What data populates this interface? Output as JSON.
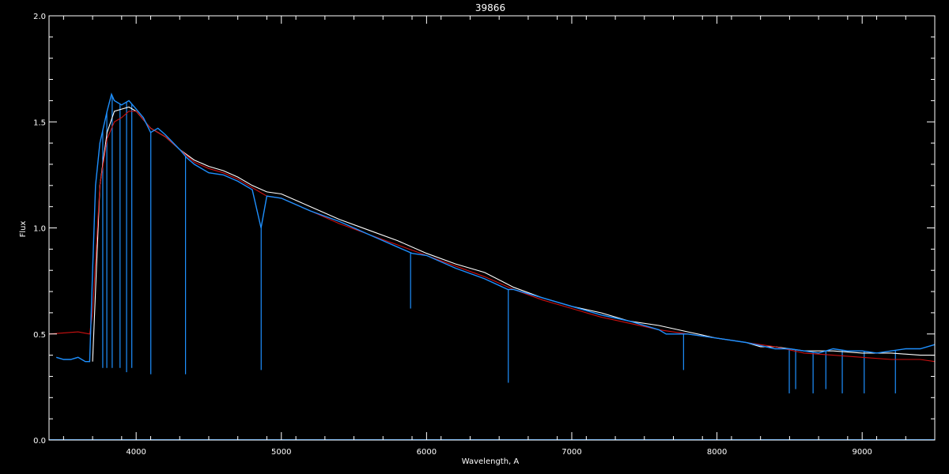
{
  "chart_data": {
    "type": "line",
    "title": "39866",
    "xlabel": "Wavelength, A",
    "ylabel": "Flux",
    "xlim": [
      3400,
      9500
    ],
    "ylim": [
      0.0,
      2.0
    ],
    "x_ticks": [
      4000,
      5000,
      6000,
      7000,
      8000,
      9000
    ],
    "y_ticks": [
      0.0,
      0.5,
      1.0,
      1.5,
      2.0
    ],
    "x_tick_labels": [
      "4000",
      "5000",
      "6000",
      "7000",
      "8000",
      "9000"
    ],
    "y_tick_labels": [
      "0.0",
      "0.5",
      "1.0",
      "1.5",
      "2.0"
    ],
    "grid": false,
    "background_color": "#000000",
    "axis_color": "#ffffff",
    "series": [
      {
        "color": "#ffffff",
        "x": [
          3700,
          3750,
          3800,
          3850,
          3900,
          3950,
          4000,
          4100,
          4200,
          4300,
          4400,
          4500,
          4600,
          4700,
          4800,
          4900,
          5000,
          5200,
          5400,
          5600,
          5800,
          6000,
          6200,
          6400,
          6600,
          6800,
          7000,
          7200,
          7400,
          7600,
          7800,
          8000,
          8200,
          8300,
          8400,
          8600,
          8800,
          9000,
          9200,
          9400,
          9500
        ],
        "y": [
          0.37,
          1.2,
          1.45,
          1.55,
          1.56,
          1.57,
          1.55,
          1.47,
          1.43,
          1.37,
          1.32,
          1.29,
          1.27,
          1.24,
          1.2,
          1.17,
          1.16,
          1.1,
          1.04,
          0.99,
          0.94,
          0.88,
          0.83,
          0.79,
          0.72,
          0.67,
          0.63,
          0.6,
          0.56,
          0.54,
          0.51,
          0.48,
          0.46,
          0.44,
          0.44,
          0.42,
          0.42,
          0.41,
          0.41,
          0.4,
          0.4
        ]
      },
      {
        "color": "#cc1111",
        "x": [
          3400,
          3600,
          3680,
          3700,
          3750,
          3800,
          3850,
          3900,
          3950,
          4000,
          4100,
          4200,
          4300,
          4400,
          4500,
          4600,
          4700,
          4800,
          4900,
          5000,
          5200,
          5400,
          5600,
          5800,
          6000,
          6200,
          6400,
          6600,
          6800,
          7000,
          7200,
          7400,
          7600,
          7800,
          8000,
          8200,
          8400,
          8600,
          8800,
          9000,
          9200,
          9400,
          9500
        ],
        "y": [
          0.5,
          0.51,
          0.5,
          0.6,
          1.2,
          1.42,
          1.5,
          1.52,
          1.55,
          1.55,
          1.47,
          1.43,
          1.37,
          1.31,
          1.28,
          1.26,
          1.23,
          1.19,
          1.15,
          1.14,
          1.08,
          1.02,
          0.97,
          0.92,
          0.87,
          0.82,
          0.77,
          0.71,
          0.66,
          0.62,
          0.58,
          0.55,
          0.52,
          0.5,
          0.48,
          0.46,
          0.44,
          0.41,
          0.4,
          0.39,
          0.38,
          0.38,
          0.37
        ]
      },
      {
        "color": "#1e90ff",
        "x": [
          3450,
          3500,
          3550,
          3600,
          3650,
          3680,
          3700,
          3720,
          3750,
          3800,
          3830,
          3850,
          3900,
          3950,
          4000,
          4050,
          4100,
          4150,
          4200,
          4300,
          4350,
          4400,
          4500,
          4600,
          4700,
          4800,
          4860,
          4900,
          5000,
          5200,
          5400,
          5600,
          5800,
          5900,
          6000,
          6200,
          6400,
          6560,
          6600,
          6800,
          7000,
          7200,
          7400,
          7600,
          7650,
          7800,
          8000,
          8200,
          8400,
          8500,
          8600,
          8700,
          8800,
          8900,
          9000,
          9100,
          9200,
          9300,
          9400,
          9500
        ],
        "y": [
          0.39,
          0.38,
          0.38,
          0.39,
          0.37,
          0.37,
          0.8,
          1.2,
          1.4,
          1.55,
          1.63,
          1.6,
          1.58,
          1.6,
          1.56,
          1.52,
          1.45,
          1.47,
          1.44,
          1.37,
          1.33,
          1.3,
          1.26,
          1.25,
          1.22,
          1.18,
          1.0,
          1.15,
          1.14,
          1.08,
          1.03,
          0.97,
          0.91,
          0.88,
          0.87,
          0.81,
          0.76,
          0.71,
          0.71,
          0.67,
          0.63,
          0.59,
          0.56,
          0.52,
          0.5,
          0.5,
          0.48,
          0.46,
          0.43,
          0.43,
          0.42,
          0.41,
          0.43,
          0.42,
          0.42,
          0.41,
          0.42,
          0.43,
          0.43,
          0.45
        ]
      }
    ],
    "absorption_lines": [
      {
        "x": 3770,
        "depth_to": 0.34
      },
      {
        "x": 3798,
        "depth_to": 0.34
      },
      {
        "x": 3835,
        "depth_to": 0.34
      },
      {
        "x": 3889,
        "depth_to": 0.34
      },
      {
        "x": 3934,
        "depth_to": 0.32
      },
      {
        "x": 3970,
        "depth_to": 0.34
      },
      {
        "x": 4101,
        "depth_to": 0.31
      },
      {
        "x": 4340,
        "depth_to": 0.31
      },
      {
        "x": 4861,
        "depth_to": 0.33
      },
      {
        "x": 5890,
        "depth_to": 0.62
      },
      {
        "x": 6563,
        "depth_to": 0.27
      },
      {
        "x": 7770,
        "depth_to": 0.33
      },
      {
        "x": 8498,
        "depth_to": 0.22
      },
      {
        "x": 8542,
        "depth_to": 0.24
      },
      {
        "x": 8662,
        "depth_to": 0.22
      },
      {
        "x": 8750,
        "depth_to": 0.24
      },
      {
        "x": 8863,
        "depth_to": 0.22
      },
      {
        "x": 9014,
        "depth_to": 0.22
      },
      {
        "x": 9229,
        "depth_to": 0.22
      }
    ]
  }
}
